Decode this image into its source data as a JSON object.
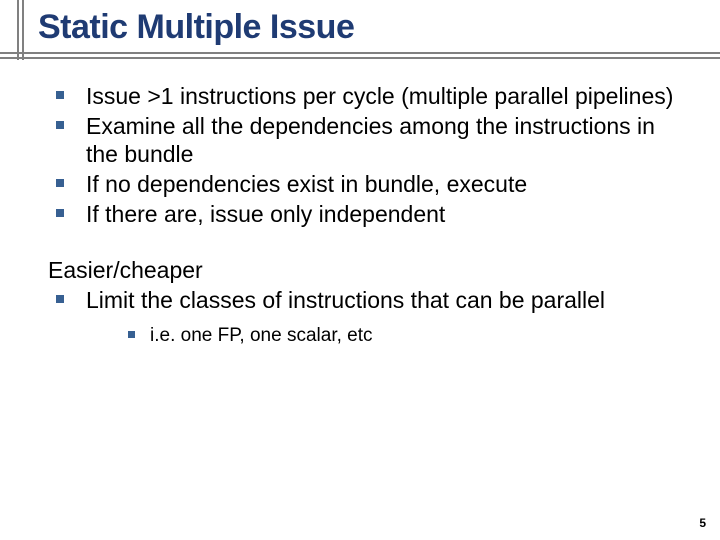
{
  "title": "Static Multiple Issue",
  "bullets_main": [
    "Issue >1 instructions per cycle (multiple parallel pipelines)",
    "Examine all the dependencies among the instructions in the bundle",
    "If no dependencies exist in bundle, execute",
    "If there are, issue only independent"
  ],
  "subtitle": "Easier/cheaper",
  "bullets_sub": [
    "Limit the classes of instructions that can be parallel"
  ],
  "bullets_subsub": [
    "i.e. one FP, one scalar, etc"
  ],
  "page_number": "5"
}
